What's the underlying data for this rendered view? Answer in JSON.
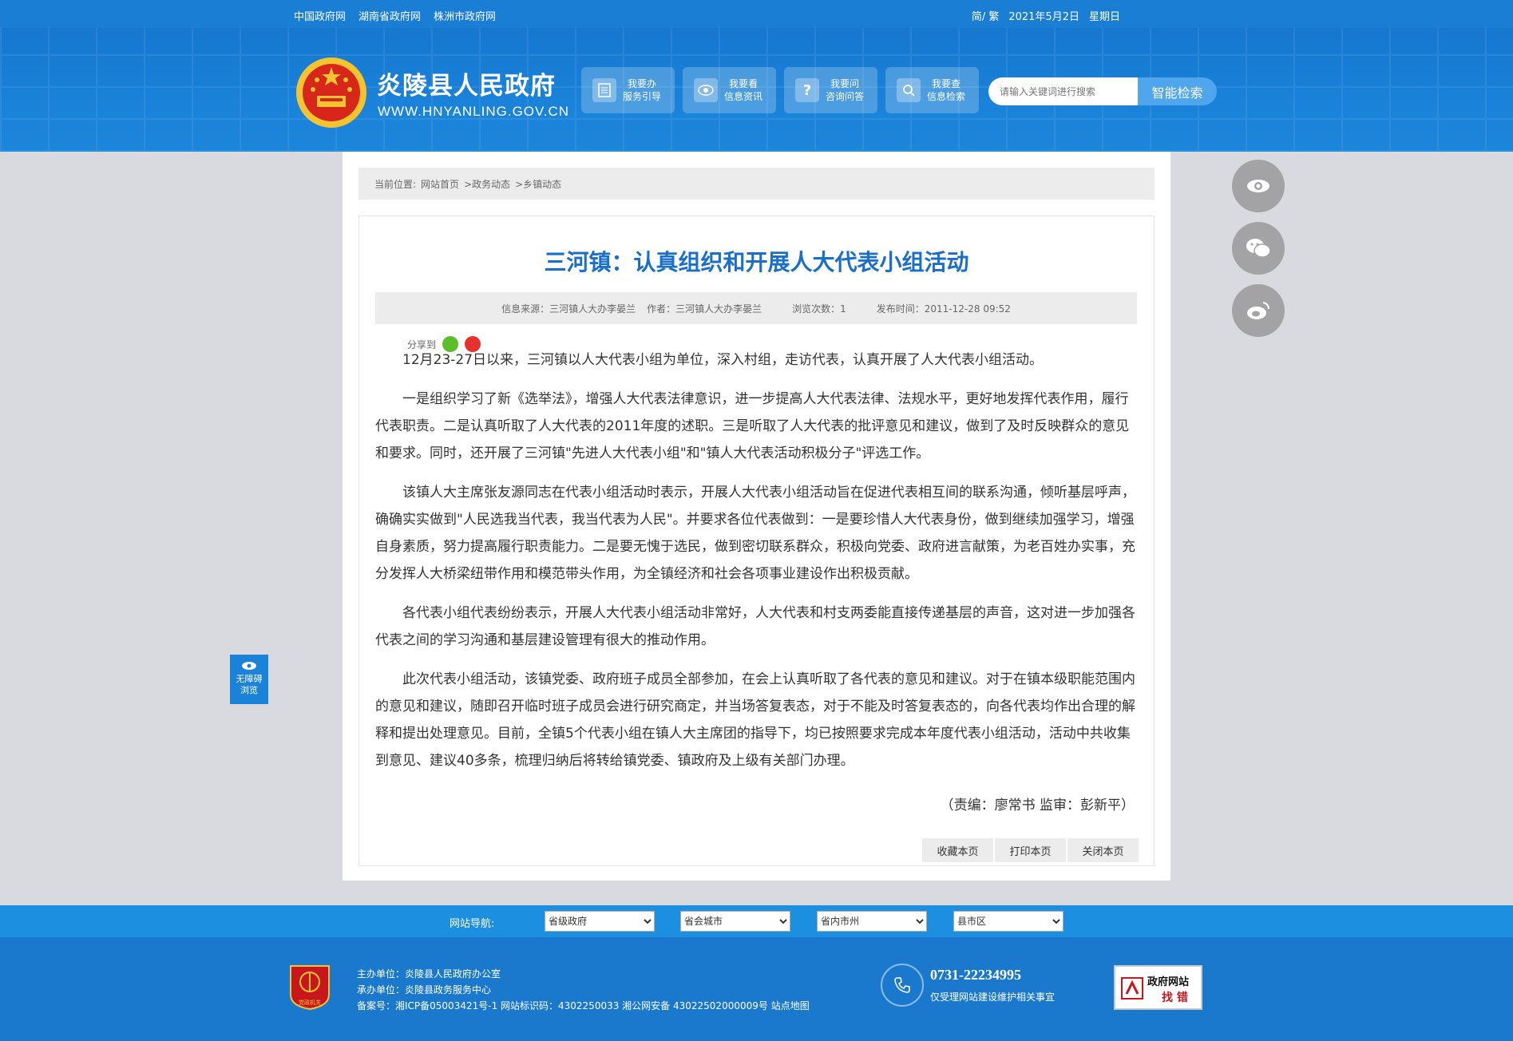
{
  "topbar": {
    "links": [
      "中国政府网",
      "湖南省政府网",
      "株洲市政府网"
    ],
    "lang": "简/ 繁",
    "date": "2021年5月2日",
    "weekday": "星期日"
  },
  "header": {
    "title": "炎陵县人民政府",
    "domain": "WWW.HNYANLING.GOV.CN",
    "quick_links": [
      {
        "line1": "我要办",
        "line2": "服务引导",
        "icon": "document-icon"
      },
      {
        "line1": "我要看",
        "line2": "信息资讯",
        "icon": "eye-icon"
      },
      {
        "line1": "我要问",
        "line2": "咨询问答",
        "icon": "question-icon"
      },
      {
        "line1": "我要查",
        "line2": "信息检索",
        "icon": "search-icon"
      }
    ],
    "search_placeholder": "请输入关键词进行搜索",
    "search_button": "智能检索"
  },
  "breadcrumb": {
    "label": "当前位置:",
    "items": [
      "网站首页",
      ">政务动态",
      ">乡镇动态"
    ]
  },
  "article": {
    "title": "三河镇：认真组织和开展人大代表小组活动",
    "meta": {
      "source": "信息来源：三河镇人大办李晏兰",
      "author": "作者：三河镇人大办李晏兰",
      "views": "浏览次数：1",
      "published": "发布时间：2011-12-28 09:52"
    },
    "share_label": "分享到",
    "paragraphs": [
      "12月23-27日以来，三河镇以人大代表小组为单位，深入村组，走访代表，认真开展了人大代表小组活动。",
      "一是组织学习了新《选举法》，增强人大代表法律意识，进一步提高人大代表法律、法规水平，更好地发挥代表作用，履行代表职责。二是认真听取了人大代表的2011年度的述职。三是听取了人大代表的批评意见和建议，做到了及时反映群众的意见和要求。同时，还开展了三河镇\"先进人大代表小组\"和\"镇人大代表活动积极分子\"评选工作。",
      "该镇人大主席张友源同志在代表小组活动时表示，开展人大代表小组活动旨在促进代表相互间的联系沟通，倾听基层呼声，确确实实做到\"人民选我当代表，我当代表为人民\"。并要求各位代表做到：一是要珍惜人大代表身份，做到继续加强学习，增强自身素质，努力提高履行职责能力。二是要无愧于选民，做到密切联系群众，积极向党委、政府进言献策，为老百姓办实事，充分发挥人大桥梁纽带作用和模范带头作用，为全镇经济和社会各项事业建设作出积极贡献。",
      "各代表小组代表纷纷表示，开展人大代表小组活动非常好，人大代表和村支两委能直接传递基层的声音，这对进一步加强各代表之间的学习沟通和基层建设管理有很大的推动作用。",
      "此次代表小组活动，该镇党委、政府班子成员全部参加，在会上认真听取了各代表的意见和建议。对于在镇本级职能范围内的意见和建议，随即召开临时班子成员会进行研究商定，并当场答复表态，对于不能及时答复表态的，向各代表均作出合理的解释和提出处理意见。目前，全镇5个代表小组在镇人大主席团的指导下，均已按照要求完成本年度代表小组活动，活动中共收集到意见、建议40多条，梳理归纳后将转给镇党委、镇政府及上级有关部门办理。"
    ],
    "editor": "（责编：廖常书  监审：彭新平）",
    "actions": [
      "收藏本页",
      "打印本页",
      "关闭本页"
    ]
  },
  "accessibility": {
    "line1": "无障碍",
    "line2": "浏览"
  },
  "footer_nav": {
    "label": "网站导航:",
    "selects": [
      "省级政府",
      "省会城市",
      "省内市州",
      "县市区"
    ]
  },
  "footer": {
    "host": "主办单位：炎陵县人民政府办公室",
    "organizer": "承办单位：炎陵县政务服务中心",
    "record": "备案号：湘ICP备05003421号-1  网站标识码：4302250033  湘公网安备 43022502000009号  站点地图",
    "badge_text": "党政机关",
    "phone": "0731-22234995",
    "phone_note": "仅受理网站建设维护相关事宜",
    "findbug_line1": "政府网站",
    "findbug_line2": "找 错"
  },
  "colors": {
    "primary": "#1a7fd4",
    "title_blue": "#1a6fc9",
    "footer": "#1a79cc"
  }
}
